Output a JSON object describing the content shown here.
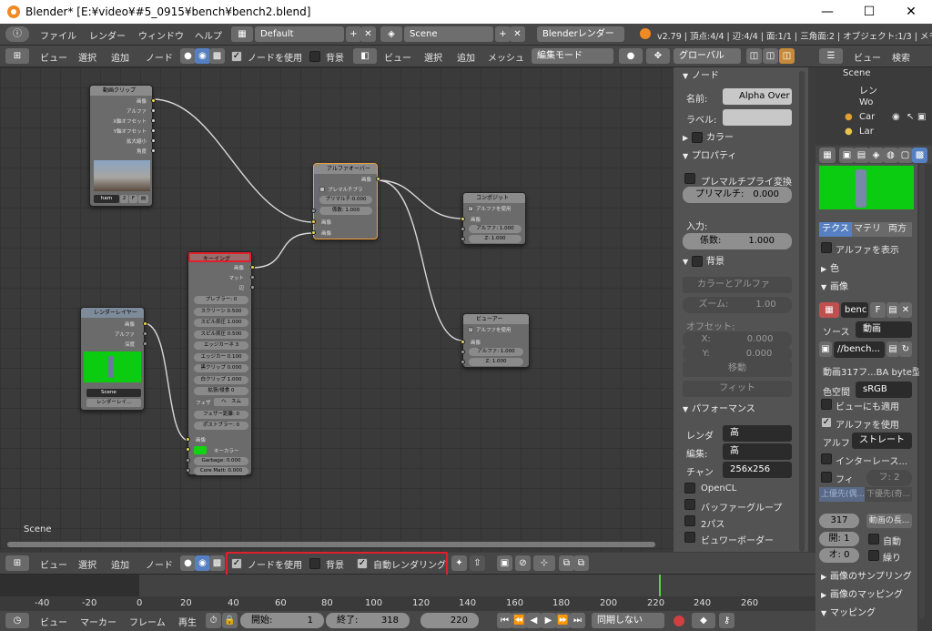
{
  "window": {
    "title": "Blender* [E:¥video¥#5_0915¥bench¥bench2.blend]",
    "min": "—",
    "max": "☐",
    "close": "✕"
  },
  "topmenu": {
    "file": "ファイル",
    "render": "レンダー",
    "window": "ウィンドウ",
    "help": "ヘルプ",
    "layout": "Default",
    "scene": "Scene",
    "engine": "Blenderレンダー",
    "stats": "v2.79 | 頂点:4/4 | 辺:4/4 | 面:1/1 | 三角面:2 | オブジェクト:1/3 | メモリ:475.62M | Plane.00"
  },
  "nodehdr": {
    "view": "ビュー",
    "select": "選択",
    "add": "追加",
    "node": "ノード",
    "use_nodes": "ノードを使用",
    "backdrop": "背景"
  },
  "view3dhdr": {
    "view": "ビュー",
    "select": "選択",
    "add": "追加",
    "mesh": "メッシュ",
    "mode": "編集モード",
    "orient": "グローバル"
  },
  "outlinerhdr": {
    "view": "ビュー",
    "search": "検索",
    "items": [
      "Scene",
      "レン",
      "Wo",
      "Car",
      "Lar"
    ]
  },
  "nodes": {
    "movie": {
      "title": "動画クリップ",
      "outs": [
        "画像",
        "アルファ",
        "X軸オフセット",
        "Y軸オフセット",
        "拡大縮小",
        "角度"
      ],
      "clip": "ham",
      "num": "2",
      "f": "F"
    },
    "alpha": {
      "title": "アルファオーバー",
      "out": "画像",
      "premul_chk": "プレマルチプラ",
      "premul": "プリマルチ:0.000",
      "fac": "係数:",
      "fac_val": "1.000",
      "in1": "画像",
      "in2": "画像"
    },
    "comp": {
      "title": "コンポジット",
      "use_alpha": "アルファを使用",
      "image": "画像",
      "alpha": "アルファ:",
      "alpha_val": "1.000",
      "z": "Z:",
      "z_val": "1.000"
    },
    "viewer": {
      "title": "ビューアー",
      "use_alpha": "アルファを使用",
      "image": "画像",
      "alpha": "アルファ:",
      "alpha_val": "1.000",
      "z": "Z:",
      "z_val": "1.000"
    },
    "keying": {
      "title": "キーイング",
      "outs": [
        "画像",
        "マット",
        "辺"
      ],
      "fields": [
        [
          "プレブラー:",
          "0"
        ],
        [
          "スクリーン",
          "0.500"
        ],
        [
          "スピル抑圧",
          "1.000"
        ],
        [
          "スピル抑圧",
          "0.500"
        ],
        [
          "エッジカーネ",
          "3"
        ],
        [
          "エッジカー",
          "0.100"
        ],
        [
          "黒クリップ",
          "0.000"
        ],
        [
          "白クリップ",
          "1.000"
        ],
        [
          "拡張/侵食",
          "0"
        ]
      ],
      "feather": "フェザ",
      "feather_val": "ヘ　スム",
      "feather_dist": "フェザー距離:",
      "feather_dist_val": "0",
      "post_blur": "ポストブラー:",
      "post_blur_val": "0",
      "in_image": "画像",
      "keycolor": "キーカラー",
      "garbage": "Garbage:",
      "garbage_val": "0.000",
      "core": "Core Matt:",
      "core_val": "0.000"
    },
    "rlayer": {
      "title": "レンダーレイヤー",
      "outs": [
        "画像",
        "アルファ",
        "深度"
      ],
      "scene": "Scene",
      "layer": "レンダーレイ..."
    }
  },
  "nodeeditor": {
    "scene_label": "Scene"
  },
  "props": {
    "node_head": "ノード",
    "name_label": "名前:",
    "name_val": "Alpha Over",
    "label_label": "ラベル:",
    "color_head": "カラー",
    "prop_head": "プロパティ",
    "premul_conv": "プレマルチプライ変換",
    "premul": "プリマルチ:",
    "premul_val": "0.000",
    "input": "入力:",
    "fac": "係数:",
    "fac_val": "1.000",
    "bg_head": "背景",
    "color_alpha": "カラーとアルファ",
    "zoom": "ズーム:",
    "zoom_val": "1.00",
    "offset": "オフセット:",
    "x": "X:",
    "x_val": "0.000",
    "y": "Y:",
    "y_val": "0.000",
    "move": "移動",
    "fit": "フィット",
    "perf_head": "パフォーマンス",
    "render": "レンダ",
    "render_val": "高",
    "edit": "編集:",
    "edit_val": "高",
    "chan": "チャン",
    "chan_val": "256x256",
    "opencl": "OpenCL",
    "buffer_groups": "バッファーグループ",
    "two_pass": "2パス",
    "viewer_border": "ビュワーボーダー"
  },
  "texprops": {
    "tabs": [
      "テクス",
      "マテリ",
      "両方"
    ],
    "show_alpha": "アルファを表示",
    "color": "色",
    "image": "画像",
    "img_name": "benc",
    "f": "F",
    "source": "ソース",
    "source_val": "動画",
    "path": "//bench...",
    "info": "動画317フ...BA byte型",
    "colorspace": "色空間",
    "colorspace_val": "sRGB",
    "apply_view": "ビューにも適用",
    "use_alpha": "アルファを使用",
    "alpha": "アルフ",
    "alpha_val": "ストレート",
    "interlace": "インターレース...",
    "fields": "フィ",
    "f2": "フ: 2",
    "upper": "上優先(偶...",
    "lower": "下優先(奇...",
    "frames": "317",
    "frames_btn": "動画の長...",
    "start": "開: 1",
    "auto": "自動",
    "offset": "オ: 0",
    "cyclic": "繰り",
    "sampling": "画像のサンプリング",
    "mapping": "画像のマッピング",
    "mapping2": "マッピング"
  },
  "bottomhdr": {
    "view": "ビュー",
    "select": "選択",
    "add": "追加",
    "node": "ノード",
    "use_nodes": "ノードを使用",
    "backdrop": "背景",
    "auto_render": "自動レンダリング"
  },
  "timeline": {
    "ticks": [
      "-40",
      "-20",
      "0",
      "20",
      "40",
      "60",
      "80",
      "100",
      "120",
      "140",
      "160",
      "180",
      "200",
      "220",
      "240",
      "260"
    ]
  },
  "timehdr": {
    "view": "ビュー",
    "marker": "マーカー",
    "frame": "フレーム",
    "play": "再生",
    "start": "開始:",
    "start_val": "1",
    "end": "終了:",
    "end_val": "318",
    "current": "220",
    "sync": "同期しない"
  }
}
